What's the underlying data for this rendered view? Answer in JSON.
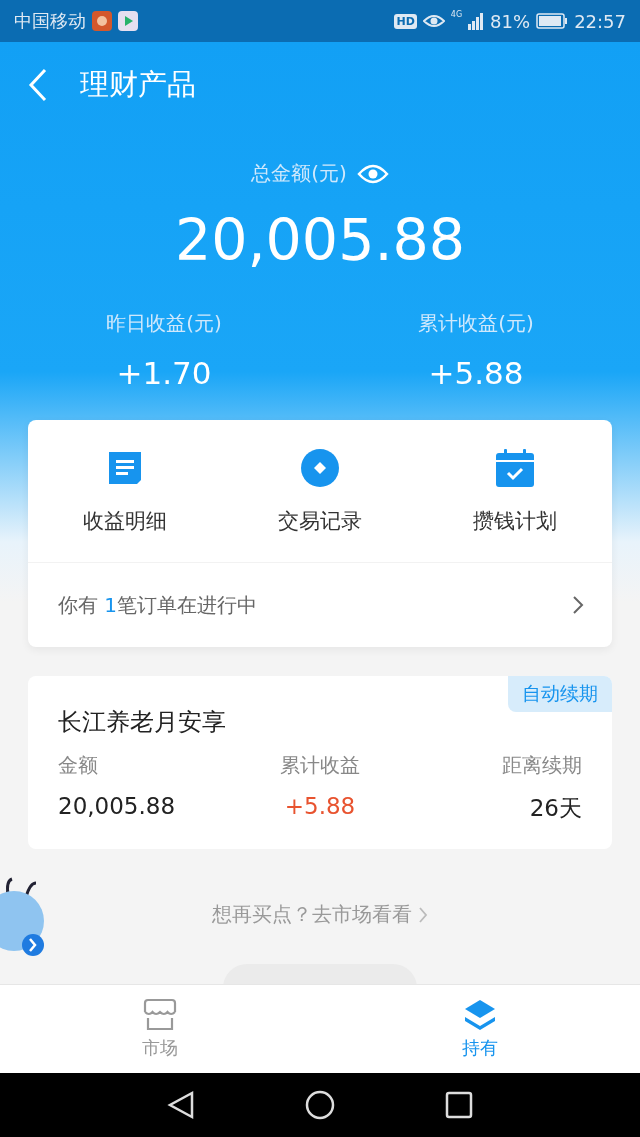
{
  "status_bar": {
    "carrier": "中国移动",
    "hd": "HD",
    "network": "4G",
    "battery": "81%",
    "time": "22:57"
  },
  "header": {
    "title": "理财产品"
  },
  "summary": {
    "total_label": "总金额(元)",
    "total": "20,005.88",
    "stats": [
      {
        "label": "昨日收益(元)",
        "value": "+1.70"
      },
      {
        "label": "累计收益(元)",
        "value": "+5.88"
      }
    ]
  },
  "actions": [
    {
      "label": "收益明细",
      "kind": "document"
    },
    {
      "label": "交易记录",
      "kind": "coin"
    },
    {
      "label": "攒钱计划",
      "kind": "calendar"
    }
  ],
  "order_notice": {
    "prefix": "你有",
    "count": "1",
    "suffix": "笔订单在进行中"
  },
  "product": {
    "name": "长江养老月安享",
    "tag": "自动续期",
    "fields": [
      {
        "label": "金额",
        "value": "20,005.88",
        "kind": "plain"
      },
      {
        "label": "累计收益",
        "value": "+5.88",
        "kind": "gain"
      },
      {
        "label": "距离续期",
        "value": "26天",
        "kind": "plain"
      }
    ]
  },
  "market_link": "想再买点？去市场看看",
  "tabs": [
    {
      "label": "市场",
      "kind": "market",
      "selected": false
    },
    {
      "label": "持有",
      "kind": "holdings",
      "selected": true
    }
  ]
}
